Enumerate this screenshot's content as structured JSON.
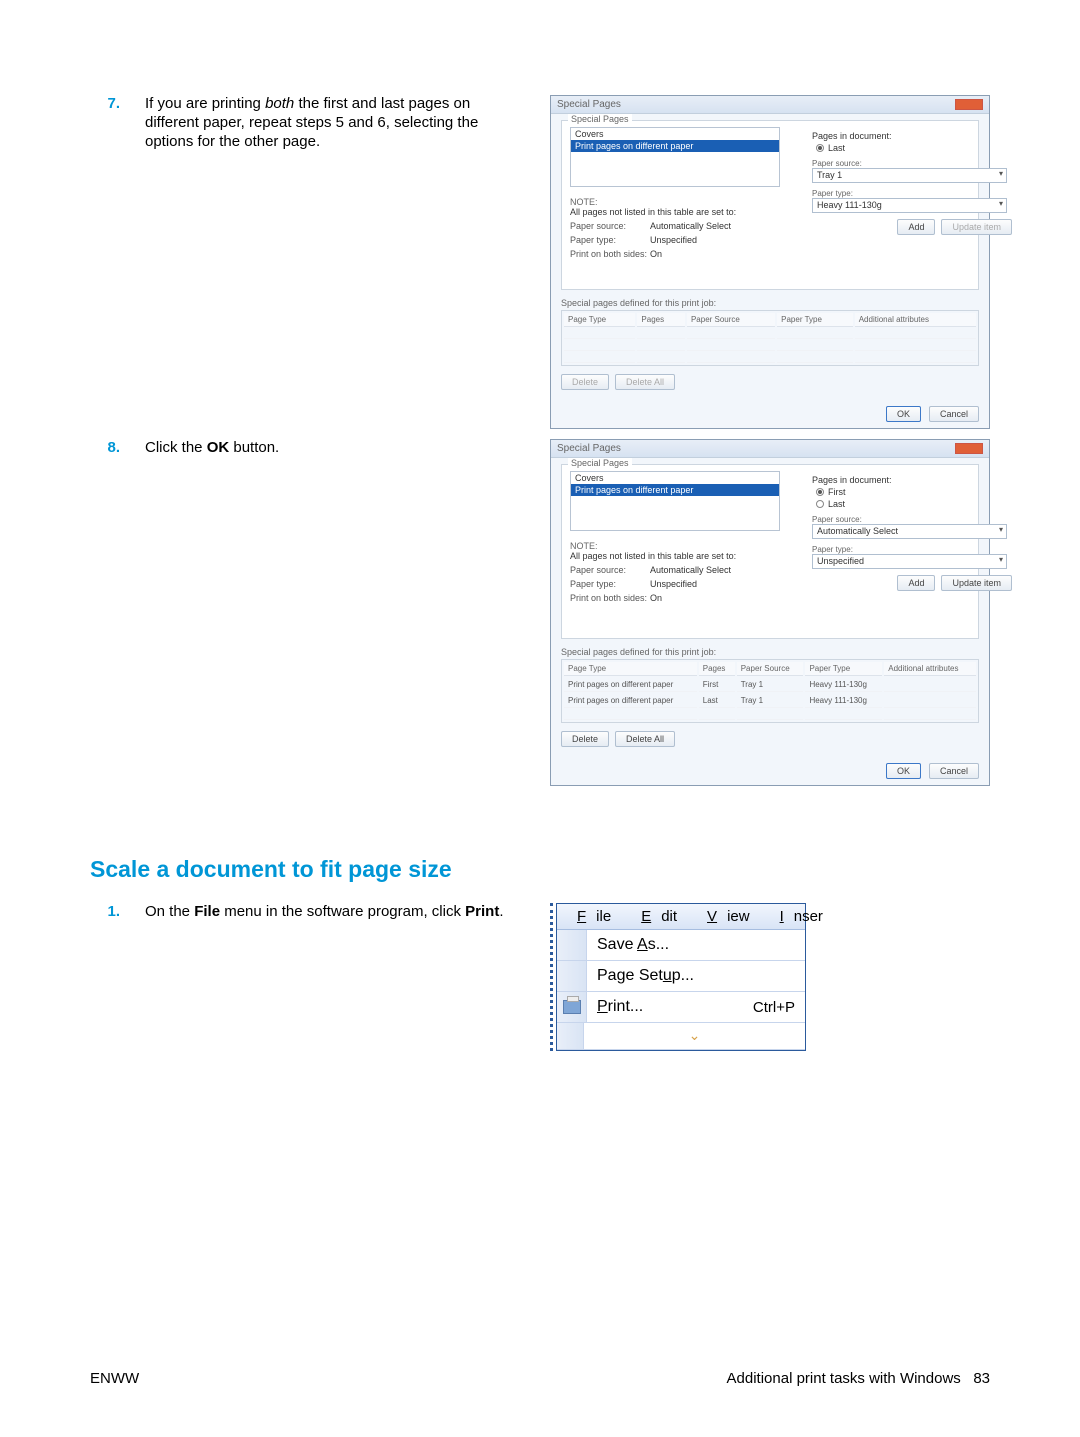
{
  "step7": {
    "num": "7.",
    "text_pre": "If you are printing ",
    "text_em": "both",
    "text_post": " the first and last pages on different paper, repeat steps 5 and 6, selecting the options for the other page."
  },
  "step8": {
    "num": "8.",
    "text_pre": "Click the ",
    "text_bold": "OK",
    "text_post": " button."
  },
  "dialog1": {
    "title": "Special Pages",
    "group": "Special Pages",
    "covers": "Covers",
    "print_diff": "Print pages on different paper",
    "pages_in_doc": "Pages in document:",
    "radio_last": "Last",
    "note": "NOTE:",
    "note_text": "All pages not listed in this table are set to:",
    "paper_source_k": "Paper source:",
    "paper_source_v": "Automatically Select",
    "paper_type_k": "Paper type:",
    "paper_type_v": "Unspecified",
    "both_sides_k": "Print on both sides:",
    "both_sides_v": "On",
    "right_paper_source": "Paper source:",
    "right_paper_source_v": "Tray 1",
    "right_paper_type": "Paper type:",
    "right_paper_type_v": "Heavy 111-130g",
    "add": "Add",
    "update": "Update item",
    "sub": "Special pages defined for this print job:",
    "th1": "Page Type",
    "th2": "Pages",
    "th3": "Paper Source",
    "th4": "Paper Type",
    "th5": "Additional attributes",
    "delete": "Delete",
    "delete_all": "Delete All",
    "ok": "OK",
    "cancel": "Cancel"
  },
  "dialog2": {
    "title": "Special Pages",
    "radio_first": "First",
    "radio_last": "Last",
    "right_paper_source_v": "Automatically Select",
    "right_paper_type_v": "Unspecified",
    "row1": {
      "c1": "Print pages on different paper",
      "c2": "First",
      "c3": "Tray 1",
      "c4": "Heavy 111-130g"
    },
    "row2": {
      "c1": "Print pages on different paper",
      "c2": "Last",
      "c3": "Tray 1",
      "c4": "Heavy 111-130g"
    }
  },
  "section_title": "Scale a document to fit page size",
  "step1": {
    "num": "1.",
    "text_pre": "On the ",
    "text_b1": "File",
    "text_mid": " menu in the software program, click ",
    "text_b2": "Print",
    "text_post": "."
  },
  "menu": {
    "file": "File",
    "edit": "Edit",
    "view": "View",
    "inser": "Inser",
    "save_as": "Save As...",
    "page_setup": "Page Setup...",
    "print": "Print...",
    "shortcut": "Ctrl+P"
  },
  "footer": {
    "left": "ENWW",
    "right_text": "Additional print tasks with Windows",
    "right_page": "83"
  }
}
